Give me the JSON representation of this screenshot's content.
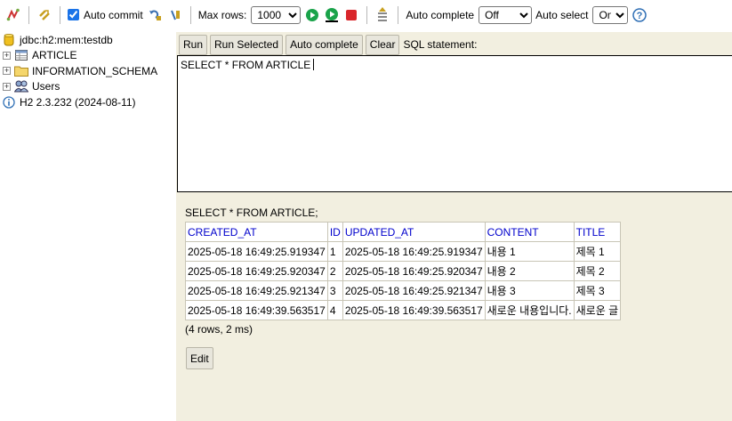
{
  "toolbar": {
    "auto_commit_label": "Auto commit",
    "auto_commit_checked": true,
    "max_rows_label": "Max rows:",
    "max_rows_value": "1000",
    "auto_complete_label": "Auto complete",
    "auto_complete_value": "Off",
    "auto_select_label": "Auto select",
    "auto_select_value": "On",
    "icons": [
      "disconnect-icon",
      "refresh-icon",
      "rollback-icon",
      "commit-icon",
      "run-icon",
      "run-selected-icon",
      "stop-icon",
      "history-icon",
      "help-icon"
    ]
  },
  "tree": {
    "connection": "jdbc:h2:mem:testdb",
    "items": [
      {
        "label": "ARTICLE",
        "icon": "table-icon"
      },
      {
        "label": "INFORMATION_SCHEMA",
        "icon": "folder-icon"
      },
      {
        "label": "Users",
        "icon": "users-icon"
      }
    ],
    "version": "H2 2.3.232 (2024-08-11)"
  },
  "editor": {
    "buttons": {
      "run": "Run",
      "run_selected": "Run Selected",
      "auto_complete": "Auto complete",
      "clear": "Clear"
    },
    "sql_label": "SQL statement:",
    "sql_text": "SELECT * FROM ARTICLE"
  },
  "result": {
    "sql": "SELECT * FROM ARTICLE;",
    "columns": [
      "CREATED_AT",
      "ID",
      "UPDATED_AT",
      "CONTENT",
      "TITLE"
    ],
    "rows": [
      [
        "2025-05-18 16:49:25.919347",
        "1",
        "2025-05-18 16:49:25.919347",
        "내용 1",
        "제목 1"
      ],
      [
        "2025-05-18 16:49:25.920347",
        "2",
        "2025-05-18 16:49:25.920347",
        "내용 2",
        "제목 2"
      ],
      [
        "2025-05-18 16:49:25.921347",
        "3",
        "2025-05-18 16:49:25.921347",
        "내용 3",
        "제목 3"
      ],
      [
        "2025-05-18 16:49:39.563517",
        "4",
        "2025-05-18 16:49:39.563517",
        "새로운 내용입니다.",
        "새로운 글"
      ]
    ],
    "row_count": "(4 rows, 2 ms)",
    "edit_label": "Edit"
  },
  "colors": {
    "panel_bg": "#f2efe0",
    "header_link": "#0000cc",
    "run_green": "#1aa34a",
    "stop_red": "#d9262b"
  }
}
